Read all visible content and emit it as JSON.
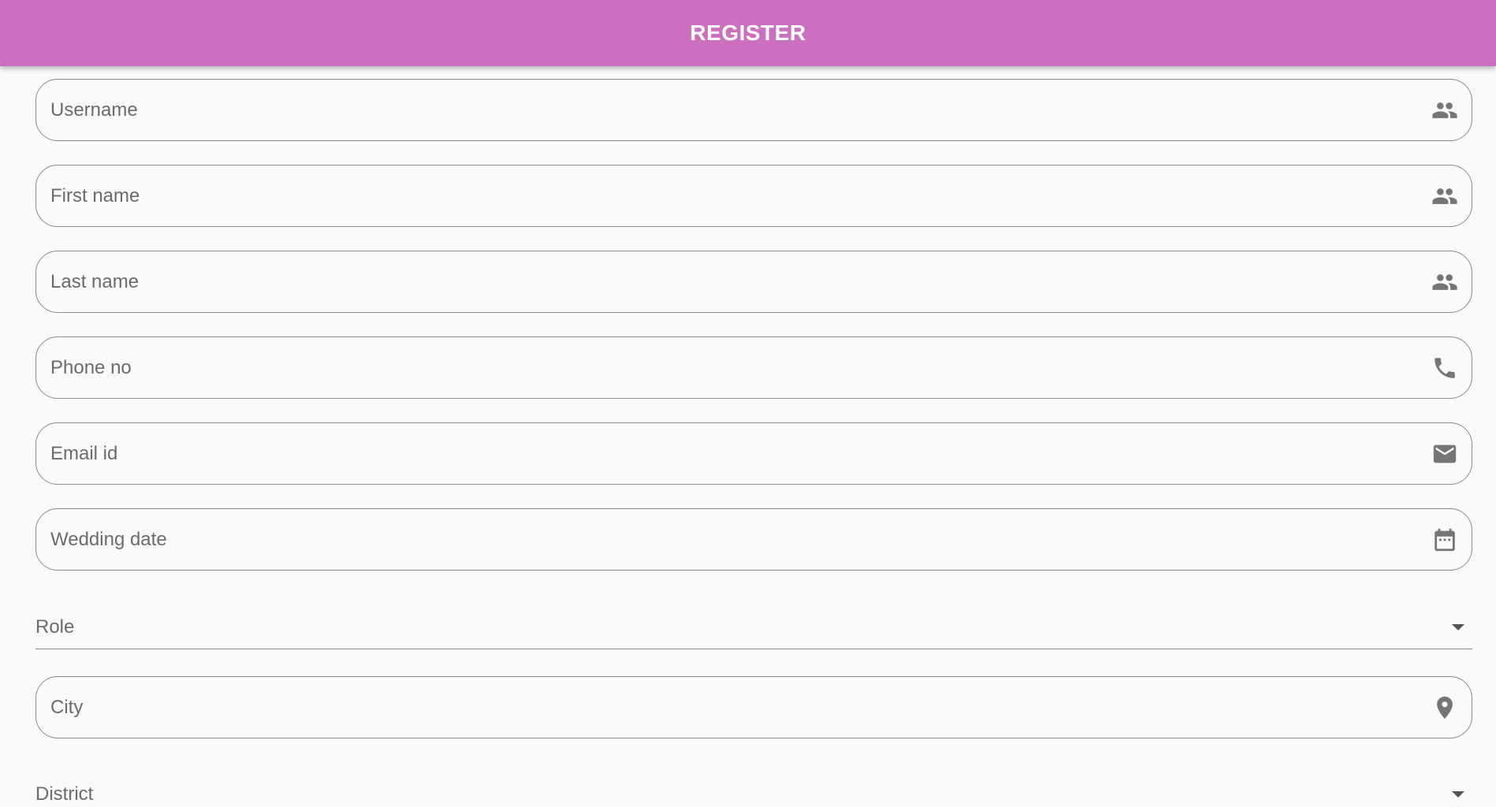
{
  "appbar": {
    "title": "REGISTER",
    "color": "#cd6fbf"
  },
  "form": {
    "username": {
      "placeholder": "Username",
      "icon": "people-icon"
    },
    "first_name": {
      "placeholder": "First name",
      "icon": "people-icon"
    },
    "last_name": {
      "placeholder": "Last name",
      "icon": "people-icon"
    },
    "phone": {
      "placeholder": "Phone no",
      "icon": "phone-icon"
    },
    "email": {
      "placeholder": "Email id",
      "icon": "mail-icon"
    },
    "wedding_date": {
      "placeholder": "Wedding date",
      "icon": "calendar-icon"
    },
    "role": {
      "label": "Role",
      "icon": "dropdown-arrow-icon"
    },
    "city": {
      "placeholder": "City",
      "icon": "location-pin-icon"
    },
    "district": {
      "label": "District",
      "icon": "dropdown-arrow-icon"
    }
  }
}
